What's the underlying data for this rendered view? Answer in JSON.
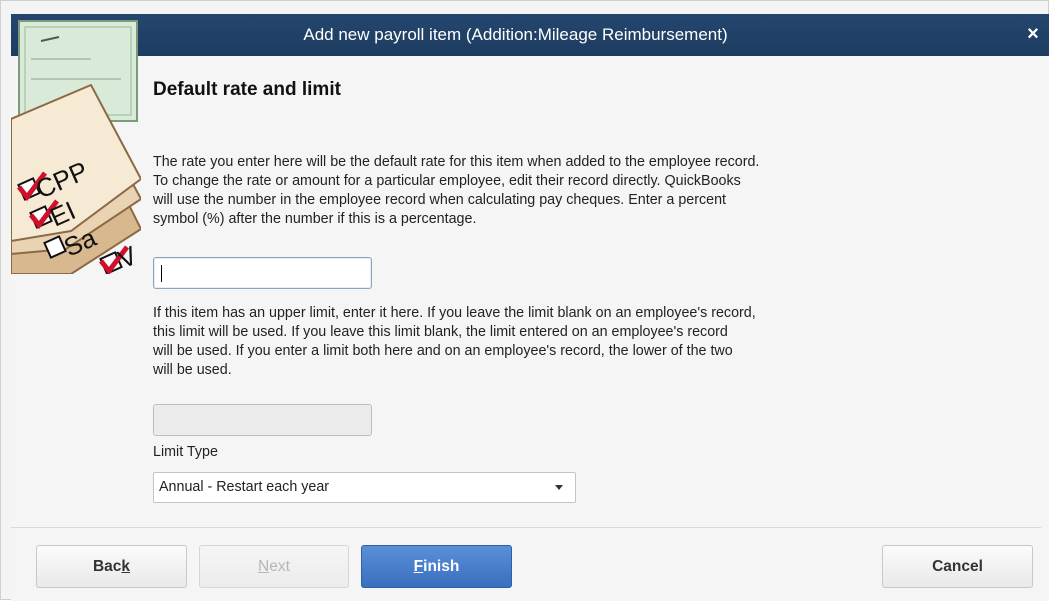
{
  "window": {
    "title": "Add new payroll item (Addition:Mileage Reimbursement)",
    "close_glyph": "×"
  },
  "illustration": {
    "checklist_items": [
      "CPP",
      "EI",
      "Sa",
      "V"
    ]
  },
  "content": {
    "heading": "Default rate and limit",
    "rate_paragraph": [
      "The rate you enter here will be the default rate for this item when added to the employee record.",
      "To change the rate or amount for a particular employee, edit their record directly.  QuickBooks",
      "will use the number in the employee record when calculating pay cheques.  Enter a percent",
      "symbol (%) after the number if this is a percentage."
    ],
    "rate_value": "",
    "limit_paragraph": [
      "If this item has an upper limit, enter it here. If you leave the limit blank on an employee's record,",
      "this limit will be used.  If you leave this limit blank, the limit entered on an employee's record",
      "will be used.  If you enter a limit both here and on an employee's  record, the lower of the two",
      "will be used."
    ],
    "limit_value": "",
    "limit_type_label": "Limit Type",
    "limit_type_selected": "Annual - Restart each year"
  },
  "buttons": {
    "back_pre": "Bac",
    "back_ul": "k",
    "next_ul": "N",
    "next_post": "ext",
    "finish_ul": "F",
    "finish_post": "inish",
    "cancel": "Cancel"
  },
  "colors": {
    "titlebar": "#1d3c60",
    "finish_button": "#3a6fbf",
    "check_red": "#d0102a"
  }
}
